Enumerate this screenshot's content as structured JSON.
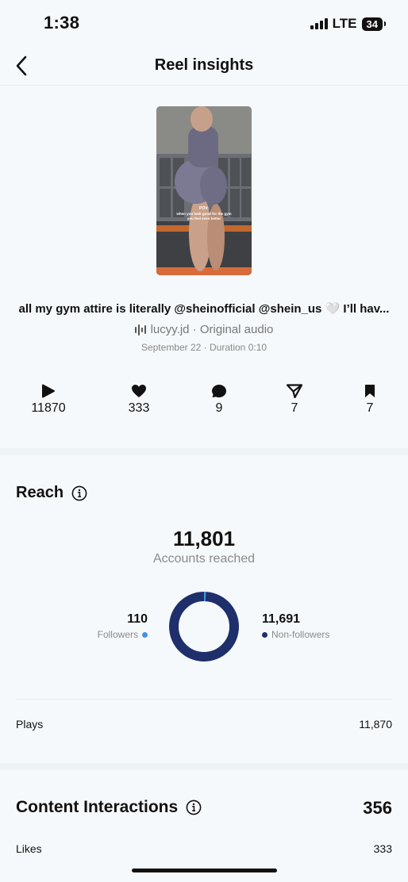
{
  "status_bar": {
    "time": "1:38",
    "network": "LTE",
    "battery": "34"
  },
  "header": {
    "title": "Reel insights"
  },
  "reel": {
    "caption": "all my gym attire is literally @sheinofficial @shein_us 🤍 I’ll hav...",
    "audio": "lucyy.jd · Original audio",
    "meta": "September 22 · Duration 0:10",
    "overlay_text_1": "POV:",
    "overlay_text_2": "when you look good for the gym",
    "overlay_text_3": "you feel even better"
  },
  "stats": {
    "plays": "11870",
    "likes": "333",
    "comments": "9",
    "shares": "7",
    "saves": "7"
  },
  "reach": {
    "title": "Reach",
    "accounts_reached": "11,801",
    "accounts_reached_label": "Accounts reached",
    "followers_value": "110",
    "followers_label": "Followers",
    "non_followers_value": "11,691",
    "non_followers_label": "Non-followers",
    "followers_fraction": 0.0093,
    "followers_color": "#4a90e2",
    "non_followers_color": "#1f2f6b",
    "plays_label": "Plays",
    "plays_value": "11,870"
  },
  "interactions": {
    "title": "Content Interactions",
    "total": "356",
    "likes_label": "Likes",
    "likes_value": "333"
  }
}
